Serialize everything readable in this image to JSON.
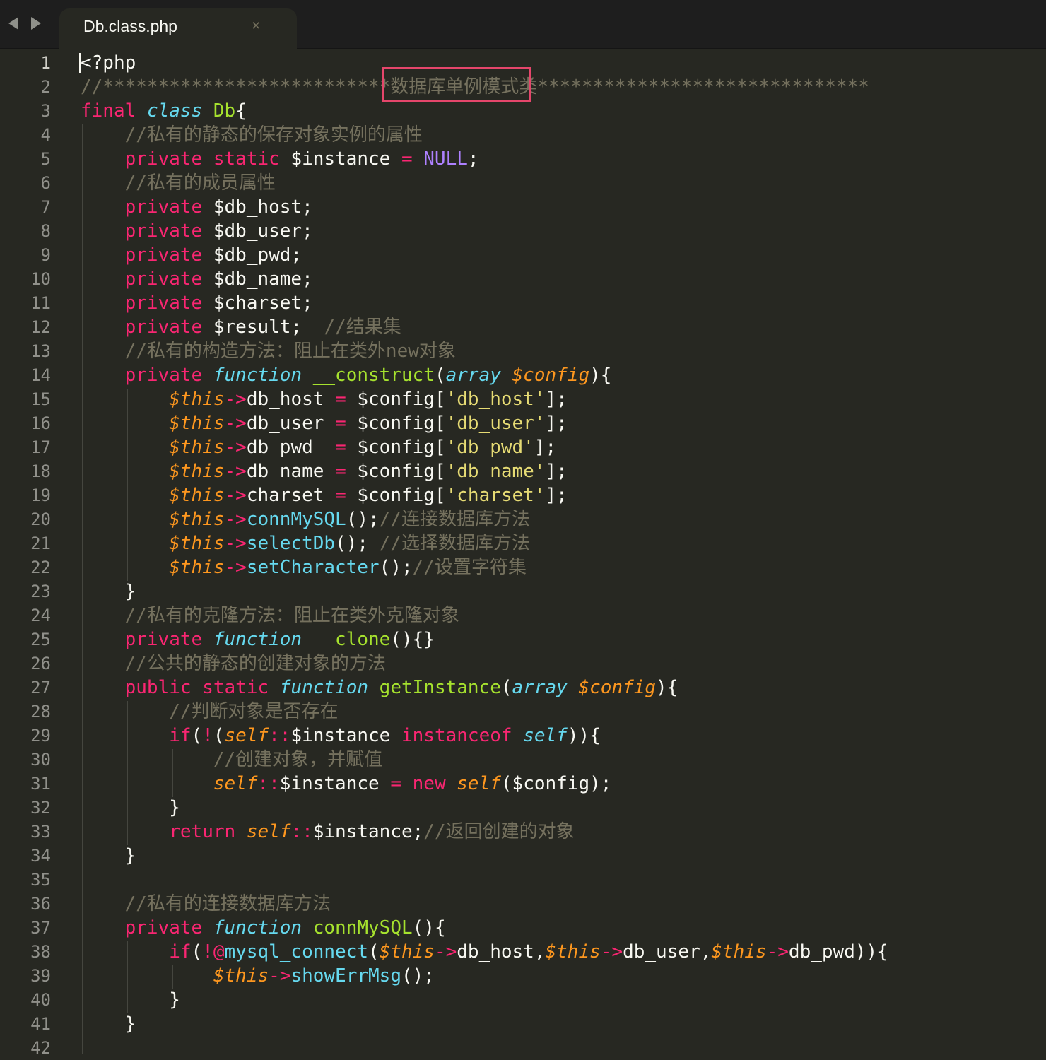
{
  "tab": {
    "title": "Db.class.php",
    "close_glyph": "×"
  },
  "colors": {
    "background": "#272822",
    "keyword": "#f92672",
    "storage": "#66d9ef",
    "function_name": "#a6e22e",
    "variable_italic": "#fd971f",
    "string": "#e6db74",
    "constant": "#ae81ff",
    "comment": "#75715e",
    "text": "#f8f8f2",
    "annotation_box": "#e5466b"
  },
  "editor": {
    "line_numbers": [
      "1",
      "2",
      "3",
      "4",
      "5",
      "6",
      "7",
      "8",
      "9",
      "10",
      "11",
      "12",
      "13",
      "14",
      "15",
      "16",
      "17",
      "18",
      "19",
      "20",
      "21",
      "22",
      "23",
      "24",
      "25",
      "26",
      "27",
      "28",
      "29",
      "30",
      "31",
      "32",
      "33",
      "34",
      "35",
      "36",
      "37",
      "38",
      "39",
      "40",
      "41",
      "42"
    ],
    "lines": [
      [
        {
          "t": "<?php",
          "c": "tx"
        }
      ],
      [
        {
          "t": "//**************************",
          "c": "cm"
        },
        {
          "t": "数据库单例模式类",
          "c": "cm"
        },
        {
          "t": "******************************",
          "c": "cm"
        }
      ],
      [
        {
          "t": "final",
          "c": "kw"
        },
        {
          "t": " ",
          "c": "tx"
        },
        {
          "t": "class",
          "c": "st"
        },
        {
          "t": " ",
          "c": "tx"
        },
        {
          "t": "Db",
          "c": "fn"
        },
        {
          "t": "{",
          "c": "tx"
        }
      ],
      [
        {
          "t": "    ",
          "c": "tx"
        },
        {
          "t": "//私有的静态的保存对象实例的属性",
          "c": "cm"
        }
      ],
      [
        {
          "t": "    ",
          "c": "tx"
        },
        {
          "t": "private",
          "c": "kw"
        },
        {
          "t": " ",
          "c": "tx"
        },
        {
          "t": "static",
          "c": "kw"
        },
        {
          "t": " $instance ",
          "c": "tx"
        },
        {
          "t": "=",
          "c": "kw"
        },
        {
          "t": " ",
          "c": "tx"
        },
        {
          "t": "NULL",
          "c": "num"
        },
        {
          "t": ";",
          "c": "tx"
        }
      ],
      [
        {
          "t": "    ",
          "c": "tx"
        },
        {
          "t": "//私有的成员属性",
          "c": "cm"
        }
      ],
      [
        {
          "t": "    ",
          "c": "tx"
        },
        {
          "t": "private",
          "c": "kw"
        },
        {
          "t": " $db_host;",
          "c": "tx"
        }
      ],
      [
        {
          "t": "    ",
          "c": "tx"
        },
        {
          "t": "private",
          "c": "kw"
        },
        {
          "t": " $db_user;",
          "c": "tx"
        }
      ],
      [
        {
          "t": "    ",
          "c": "tx"
        },
        {
          "t": "private",
          "c": "kw"
        },
        {
          "t": " $db_pwd;",
          "c": "tx"
        }
      ],
      [
        {
          "t": "    ",
          "c": "tx"
        },
        {
          "t": "private",
          "c": "kw"
        },
        {
          "t": " $db_name;",
          "c": "tx"
        }
      ],
      [
        {
          "t": "    ",
          "c": "tx"
        },
        {
          "t": "private",
          "c": "kw"
        },
        {
          "t": " $charset;",
          "c": "tx"
        }
      ],
      [
        {
          "t": "    ",
          "c": "tx"
        },
        {
          "t": "private",
          "c": "kw"
        },
        {
          "t": " $result;  ",
          "c": "tx"
        },
        {
          "t": "//结果集",
          "c": "cm"
        }
      ],
      [
        {
          "t": "    ",
          "c": "tx"
        },
        {
          "t": "//私有的构造方法：阻止在类外new对象",
          "c": "cm"
        }
      ],
      [
        {
          "t": "    ",
          "c": "tx"
        },
        {
          "t": "private",
          "c": "kw"
        },
        {
          "t": " ",
          "c": "tx"
        },
        {
          "t": "function",
          "c": "st"
        },
        {
          "t": " ",
          "c": "tx"
        },
        {
          "t": "__construct",
          "c": "fn"
        },
        {
          "t": "(",
          "c": "tx"
        },
        {
          "t": "array",
          "c": "st"
        },
        {
          "t": " ",
          "c": "tx"
        },
        {
          "t": "$config",
          "c": "pm"
        },
        {
          "t": "){",
          "c": "tx"
        }
      ],
      [
        {
          "t": "        ",
          "c": "tx"
        },
        {
          "t": "$this",
          "c": "pm"
        },
        {
          "t": "->",
          "c": "kw"
        },
        {
          "t": "db_host ",
          "c": "tx"
        },
        {
          "t": "=",
          "c": "kw"
        },
        {
          "t": " $config[",
          "c": "tx"
        },
        {
          "t": "'db_host'",
          "c": "str"
        },
        {
          "t": "];",
          "c": "tx"
        }
      ],
      [
        {
          "t": "        ",
          "c": "tx"
        },
        {
          "t": "$this",
          "c": "pm"
        },
        {
          "t": "->",
          "c": "kw"
        },
        {
          "t": "db_user ",
          "c": "tx"
        },
        {
          "t": "=",
          "c": "kw"
        },
        {
          "t": " $config[",
          "c": "tx"
        },
        {
          "t": "'db_user'",
          "c": "str"
        },
        {
          "t": "];",
          "c": "tx"
        }
      ],
      [
        {
          "t": "        ",
          "c": "tx"
        },
        {
          "t": "$this",
          "c": "pm"
        },
        {
          "t": "->",
          "c": "kw"
        },
        {
          "t": "db_pwd  ",
          "c": "tx"
        },
        {
          "t": "=",
          "c": "kw"
        },
        {
          "t": " $config[",
          "c": "tx"
        },
        {
          "t": "'db_pwd'",
          "c": "str"
        },
        {
          "t": "];",
          "c": "tx"
        }
      ],
      [
        {
          "t": "        ",
          "c": "tx"
        },
        {
          "t": "$this",
          "c": "pm"
        },
        {
          "t": "->",
          "c": "kw"
        },
        {
          "t": "db_name ",
          "c": "tx"
        },
        {
          "t": "=",
          "c": "kw"
        },
        {
          "t": " $config[",
          "c": "tx"
        },
        {
          "t": "'db_name'",
          "c": "str"
        },
        {
          "t": "];",
          "c": "tx"
        }
      ],
      [
        {
          "t": "        ",
          "c": "tx"
        },
        {
          "t": "$this",
          "c": "pm"
        },
        {
          "t": "->",
          "c": "kw"
        },
        {
          "t": "charset ",
          "c": "tx"
        },
        {
          "t": "=",
          "c": "kw"
        },
        {
          "t": " $config[",
          "c": "tx"
        },
        {
          "t": "'charset'",
          "c": "str"
        },
        {
          "t": "];",
          "c": "tx"
        }
      ],
      [
        {
          "t": "        ",
          "c": "tx"
        },
        {
          "t": "$this",
          "c": "pm"
        },
        {
          "t": "->",
          "c": "kw"
        },
        {
          "t": "connMySQL",
          "c": "mth"
        },
        {
          "t": "();",
          "c": "tx"
        },
        {
          "t": "//连接数据库方法",
          "c": "cm"
        }
      ],
      [
        {
          "t": "        ",
          "c": "tx"
        },
        {
          "t": "$this",
          "c": "pm"
        },
        {
          "t": "->",
          "c": "kw"
        },
        {
          "t": "selectDb",
          "c": "mth"
        },
        {
          "t": "(); ",
          "c": "tx"
        },
        {
          "t": "//选择数据库方法",
          "c": "cm"
        }
      ],
      [
        {
          "t": "        ",
          "c": "tx"
        },
        {
          "t": "$this",
          "c": "pm"
        },
        {
          "t": "->",
          "c": "kw"
        },
        {
          "t": "setCharacter",
          "c": "mth"
        },
        {
          "t": "();",
          "c": "tx"
        },
        {
          "t": "//设置字符集",
          "c": "cm"
        }
      ],
      [
        {
          "t": "    }",
          "c": "tx"
        }
      ],
      [
        {
          "t": "    ",
          "c": "tx"
        },
        {
          "t": "//私有的克隆方法：阻止在类外克隆对象",
          "c": "cm"
        }
      ],
      [
        {
          "t": "    ",
          "c": "tx"
        },
        {
          "t": "private",
          "c": "kw"
        },
        {
          "t": " ",
          "c": "tx"
        },
        {
          "t": "function",
          "c": "st"
        },
        {
          "t": " ",
          "c": "tx"
        },
        {
          "t": "__clone",
          "c": "fn"
        },
        {
          "t": "(){}",
          "c": "tx"
        }
      ],
      [
        {
          "t": "    ",
          "c": "tx"
        },
        {
          "t": "//公共的静态的创建对象的方法",
          "c": "cm"
        }
      ],
      [
        {
          "t": "    ",
          "c": "tx"
        },
        {
          "t": "public",
          "c": "kw"
        },
        {
          "t": " ",
          "c": "tx"
        },
        {
          "t": "static",
          "c": "kw"
        },
        {
          "t": " ",
          "c": "tx"
        },
        {
          "t": "function",
          "c": "st"
        },
        {
          "t": " ",
          "c": "tx"
        },
        {
          "t": "getInstance",
          "c": "fn"
        },
        {
          "t": "(",
          "c": "tx"
        },
        {
          "t": "array",
          "c": "st"
        },
        {
          "t": " ",
          "c": "tx"
        },
        {
          "t": "$config",
          "c": "pm"
        },
        {
          "t": "){",
          "c": "tx"
        }
      ],
      [
        {
          "t": "        ",
          "c": "tx"
        },
        {
          "t": "//判断对象是否存在",
          "c": "cm"
        }
      ],
      [
        {
          "t": "        ",
          "c": "tx"
        },
        {
          "t": "if",
          "c": "kw"
        },
        {
          "t": "(",
          "c": "tx"
        },
        {
          "t": "!",
          "c": "kw"
        },
        {
          "t": "(",
          "c": "tx"
        },
        {
          "t": "self",
          "c": "pm"
        },
        {
          "t": "::",
          "c": "kw"
        },
        {
          "t": "$instance ",
          "c": "tx"
        },
        {
          "t": "instanceof",
          "c": "kw"
        },
        {
          "t": " ",
          "c": "tx"
        },
        {
          "t": "self",
          "c": "st"
        },
        {
          "t": ")){",
          "c": "tx"
        }
      ],
      [
        {
          "t": "            ",
          "c": "tx"
        },
        {
          "t": "//创建对象，并赋值",
          "c": "cm"
        }
      ],
      [
        {
          "t": "            ",
          "c": "tx"
        },
        {
          "t": "self",
          "c": "pm"
        },
        {
          "t": "::",
          "c": "kw"
        },
        {
          "t": "$instance ",
          "c": "tx"
        },
        {
          "t": "=",
          "c": "kw"
        },
        {
          "t": " ",
          "c": "tx"
        },
        {
          "t": "new",
          "c": "kw"
        },
        {
          "t": " ",
          "c": "tx"
        },
        {
          "t": "self",
          "c": "pm"
        },
        {
          "t": "($config);",
          "c": "tx"
        }
      ],
      [
        {
          "t": "        }",
          "c": "tx"
        }
      ],
      [
        {
          "t": "        ",
          "c": "tx"
        },
        {
          "t": "return",
          "c": "kw"
        },
        {
          "t": " ",
          "c": "tx"
        },
        {
          "t": "self",
          "c": "pm"
        },
        {
          "t": "::",
          "c": "kw"
        },
        {
          "t": "$instance;",
          "c": "tx"
        },
        {
          "t": "//返回创建的对象",
          "c": "cm"
        }
      ],
      [
        {
          "t": "    }",
          "c": "tx"
        }
      ],
      [
        {
          "t": "",
          "c": "tx"
        }
      ],
      [
        {
          "t": "    ",
          "c": "tx"
        },
        {
          "t": "//私有的连接数据库方法",
          "c": "cm"
        }
      ],
      [
        {
          "t": "    ",
          "c": "tx"
        },
        {
          "t": "private",
          "c": "kw"
        },
        {
          "t": " ",
          "c": "tx"
        },
        {
          "t": "function",
          "c": "st"
        },
        {
          "t": " ",
          "c": "tx"
        },
        {
          "t": "connMySQL",
          "c": "fn"
        },
        {
          "t": "(){",
          "c": "tx"
        }
      ],
      [
        {
          "t": "        ",
          "c": "tx"
        },
        {
          "t": "if",
          "c": "kw"
        },
        {
          "t": "(",
          "c": "tx"
        },
        {
          "t": "!@",
          "c": "kw"
        },
        {
          "t": "mysql_connect",
          "c": "mth"
        },
        {
          "t": "(",
          "c": "tx"
        },
        {
          "t": "$this",
          "c": "pm"
        },
        {
          "t": "->",
          "c": "kw"
        },
        {
          "t": "db_host,",
          "c": "tx"
        },
        {
          "t": "$this",
          "c": "pm"
        },
        {
          "t": "->",
          "c": "kw"
        },
        {
          "t": "db_user,",
          "c": "tx"
        },
        {
          "t": "$this",
          "c": "pm"
        },
        {
          "t": "->",
          "c": "kw"
        },
        {
          "t": "db_pwd)){",
          "c": "tx"
        }
      ],
      [
        {
          "t": "            ",
          "c": "tx"
        },
        {
          "t": "$this",
          "c": "pm"
        },
        {
          "t": "->",
          "c": "kw"
        },
        {
          "t": "showErrMsg",
          "c": "mth"
        },
        {
          "t": "();",
          "c": "tx"
        }
      ],
      [
        {
          "t": "        }",
          "c": "tx"
        }
      ],
      [
        {
          "t": "    }",
          "c": "tx"
        }
      ],
      [
        {
          "t": "",
          "c": "tx"
        }
      ]
    ]
  }
}
